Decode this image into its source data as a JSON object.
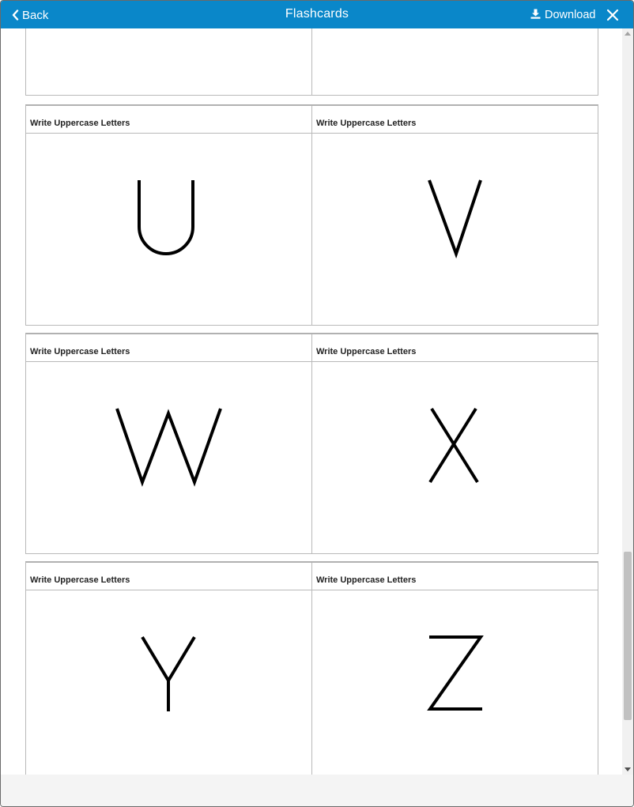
{
  "header": {
    "back_label": "Back",
    "title": "Flashcards",
    "download_label": "Download"
  },
  "colors": {
    "header_bg": "#0a87c9",
    "header_text": "#ffffff",
    "card_border": "#b9b9b9"
  },
  "icons": {
    "back": "chevron-left-icon",
    "download": "download-icon",
    "close": "close-icon"
  },
  "card_rows": [
    {
      "cards": [
        {
          "header": "Write Uppercase Letters",
          "letter": "U"
        },
        {
          "header": "Write Uppercase Letters",
          "letter": "V"
        }
      ]
    },
    {
      "cards": [
        {
          "header": "Write Uppercase Letters",
          "letter": "W"
        },
        {
          "header": "Write Uppercase Letters",
          "letter": "X"
        }
      ]
    },
    {
      "cards": [
        {
          "header": "Write Uppercase Letters",
          "letter": "Y"
        },
        {
          "header": "Write Uppercase Letters",
          "letter": "Z"
        }
      ]
    }
  ]
}
